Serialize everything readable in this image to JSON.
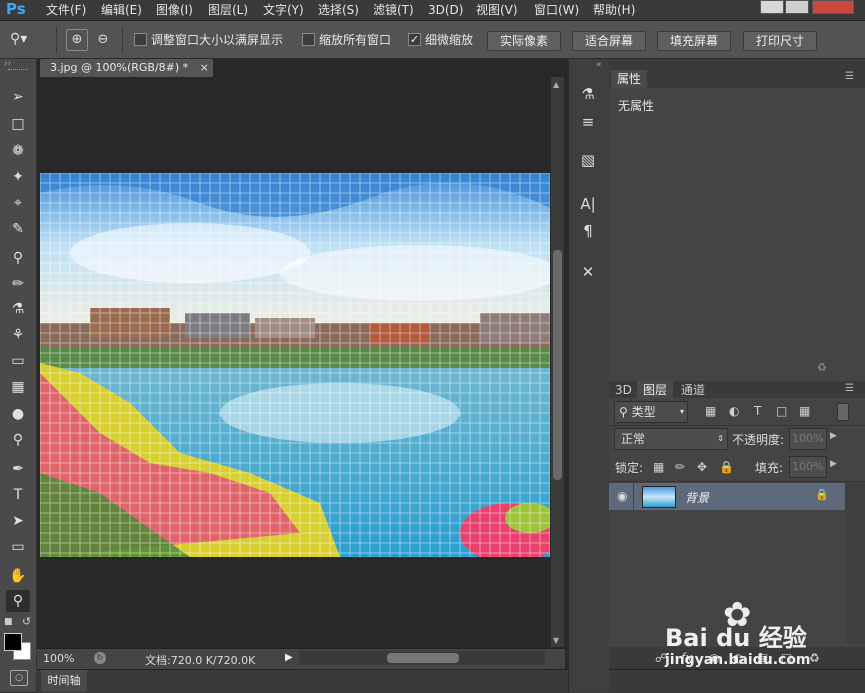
{
  "app": {
    "logo": "Ps"
  },
  "menu": [
    "文件(F)",
    "编辑(E)",
    "图像(I)",
    "图层(L)",
    "文字(Y)",
    "选择(S)",
    "滤镜(T)",
    "3D(D)",
    "视图(V)",
    "窗口(W)",
    "帮助(H)"
  ],
  "options": {
    "resize_window": "调整窗口大小以满屏显示",
    "zoom_all": "缩放所有窗口",
    "scrubby_zoom": "细微缩放",
    "actual_pixels": "实际像素",
    "fit_screen": "适合屏幕",
    "fill_screen": "填充屏幕",
    "print_size": "打印尺寸"
  },
  "document": {
    "tab": "3.jpg @ 100%(RGB/8#) *",
    "close": "×",
    "zoom": "100%",
    "doc_info": "文档:720.0 K/720.0K"
  },
  "timeline": {
    "label": "时间轴"
  },
  "properties": {
    "tab": "属性",
    "content": "无属性"
  },
  "layers": {
    "tabs": [
      "3D",
      "图层",
      "通道"
    ],
    "filter_type": "类型",
    "blend_mode": "正常",
    "opacity_label": "不透明度:",
    "opacity_value": "100%",
    "lock_label": "锁定:",
    "fill_label": "填充:",
    "fill_value": "100%",
    "layer_name": "背景"
  },
  "watermark": {
    "brand": "Bai du 经验",
    "url": "jingyan.baidu.com"
  },
  "colors": {
    "accent": "#3ea6f4",
    "panel": "#444444",
    "selected_layer": "#5d6a7c"
  }
}
